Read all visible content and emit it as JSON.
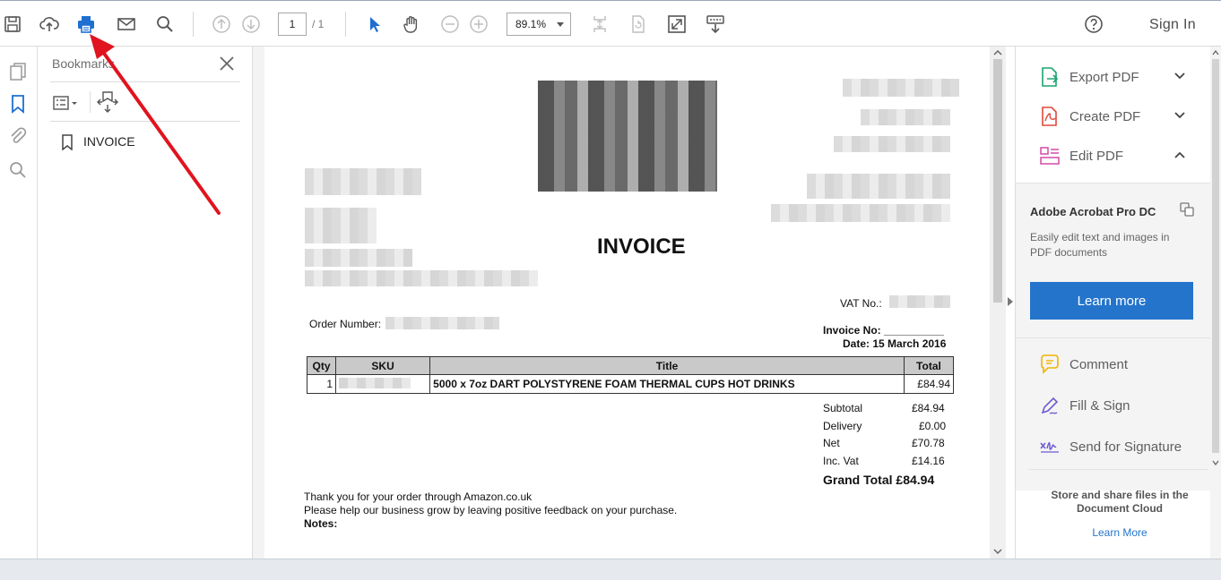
{
  "toolbar": {
    "page_current": "1",
    "page_total": "/ 1",
    "zoom": "89.1%",
    "sign_in": "Sign In"
  },
  "bookmarks": {
    "title": "Bookmarks",
    "items": [
      {
        "label": "INVOICE"
      }
    ]
  },
  "invoice": {
    "title": "INVOICE",
    "vat_label": "VAT No.:",
    "order_label": "Order Number:",
    "invoice_no": "Invoice No: __________",
    "date": "Date: 15 March 2016",
    "table": {
      "headers": [
        "Qty",
        "SKU",
        "Title",
        "Total"
      ],
      "rows": [
        {
          "qty": "1",
          "sku": "",
          "title": "5000 x 7oz DART POLYSTYRENE FOAM THERMAL CUPS HOT DRINKS",
          "total": "£84.94"
        }
      ]
    },
    "totals": [
      {
        "label": "Subtotal",
        "value": "£84.94"
      },
      {
        "label": "Delivery",
        "value": "£0.00"
      },
      {
        "label": "Net",
        "value": "£70.78"
      },
      {
        "label": "Inc. Vat",
        "value": "£14.16"
      }
    ],
    "grand_total": "Grand Total £84.94",
    "thanks": "Thank you for your order through Amazon.co.uk",
    "feedback": "Please help our business grow by leaving positive feedback on your purchase.",
    "notes": "Notes:"
  },
  "right_pane": {
    "tools": [
      {
        "label": "Export PDF"
      },
      {
        "label": "Create PDF"
      },
      {
        "label": "Edit PDF"
      }
    ],
    "promo_title": "Adobe Acrobat Pro DC",
    "promo_text": "Easily edit text and images in PDF documents",
    "learn_more_button": "Learn more",
    "subtools": [
      {
        "label": "Comment"
      },
      {
        "label": "Fill & Sign"
      },
      {
        "label": "Send for Signature"
      }
    ],
    "store_text": "Store and share files in the Document Cloud",
    "learn_more_link": "Learn More"
  },
  "colors": {
    "accent": "#2474cc",
    "annotation_arrow": "#e0141e"
  }
}
